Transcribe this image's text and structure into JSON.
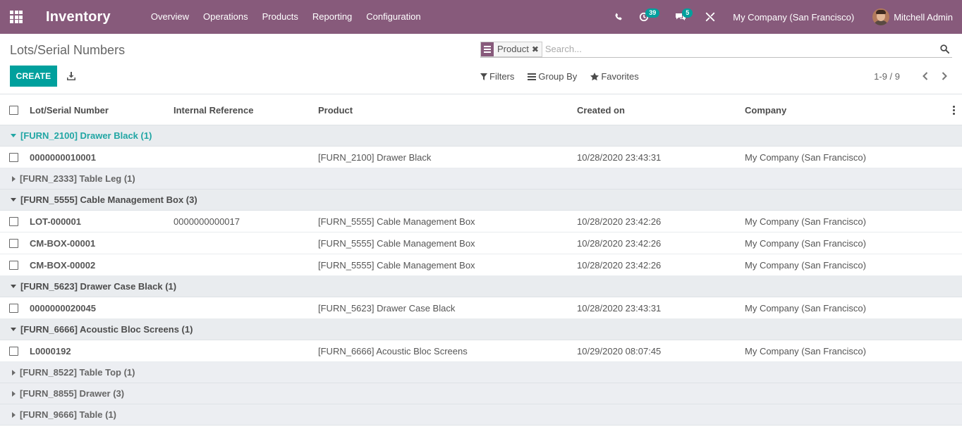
{
  "navbar": {
    "app_name": "Inventory",
    "menu": [
      "Overview",
      "Operations",
      "Products",
      "Reporting",
      "Configuration"
    ],
    "activity_count": "39",
    "message_count": "5",
    "company": "My Company (San Francisco)",
    "user": "Mitchell Admin",
    "colors": {
      "brand": "#875a7b",
      "badge": "#00a09d"
    }
  },
  "control_panel": {
    "breadcrumb": "Lots/Serial Numbers",
    "create_label": "CREATE",
    "search": {
      "facet_value": "Product",
      "placeholder": "Search..."
    },
    "filters_label": "Filters",
    "group_by_label": "Group By",
    "favorites_label": "Favorites",
    "pager": "1-9 / 9"
  },
  "table": {
    "columns": [
      "Lot/Serial Number",
      "Internal Reference",
      "Product",
      "Created on",
      "Company"
    ],
    "groups": [
      {
        "label": "[FURN_2100] Drawer Black (1)",
        "open": true,
        "rows": [
          {
            "lot": "0000000010001",
            "ref": "",
            "product": "[FURN_2100] Drawer Black",
            "created": "10/28/2020 23:43:31",
            "company": "My Company (San Francisco)"
          }
        ]
      },
      {
        "label": "[FURN_2333] Table Leg (1)",
        "open": false,
        "rows": []
      },
      {
        "label": "[FURN_5555] Cable Management Box (3)",
        "open": true,
        "rows": [
          {
            "lot": "LOT-000001",
            "ref": "0000000000017",
            "product": "[FURN_5555] Cable Management Box",
            "created": "10/28/2020 23:42:26",
            "company": "My Company (San Francisco)"
          },
          {
            "lot": "CM-BOX-00001",
            "ref": "",
            "product": "[FURN_5555] Cable Management Box",
            "created": "10/28/2020 23:42:26",
            "company": "My Company (San Francisco)"
          },
          {
            "lot": "CM-BOX-00002",
            "ref": "",
            "product": "[FURN_5555] Cable Management Box",
            "created": "10/28/2020 23:42:26",
            "company": "My Company (San Francisco)"
          }
        ]
      },
      {
        "label": "[FURN_5623] Drawer Case Black (1)",
        "open": true,
        "rows": [
          {
            "lot": "0000000020045",
            "ref": "",
            "product": "[FURN_5623] Drawer Case Black",
            "created": "10/28/2020 23:43:31",
            "company": "My Company (San Francisco)"
          }
        ]
      },
      {
        "label": "[FURN_6666] Acoustic Bloc Screens (1)",
        "open": true,
        "rows": [
          {
            "lot": "L0000192",
            "ref": "",
            "product": "[FURN_6666] Acoustic Bloc Screens",
            "created": "10/29/2020 08:07:45",
            "company": "My Company (San Francisco)"
          }
        ]
      },
      {
        "label": "[FURN_8522] Table Top (1)",
        "open": false,
        "rows": []
      },
      {
        "label": "[FURN_8855] Drawer (3)",
        "open": false,
        "rows": []
      },
      {
        "label": "[FURN_9666] Table (1)",
        "open": false,
        "rows": []
      }
    ]
  }
}
